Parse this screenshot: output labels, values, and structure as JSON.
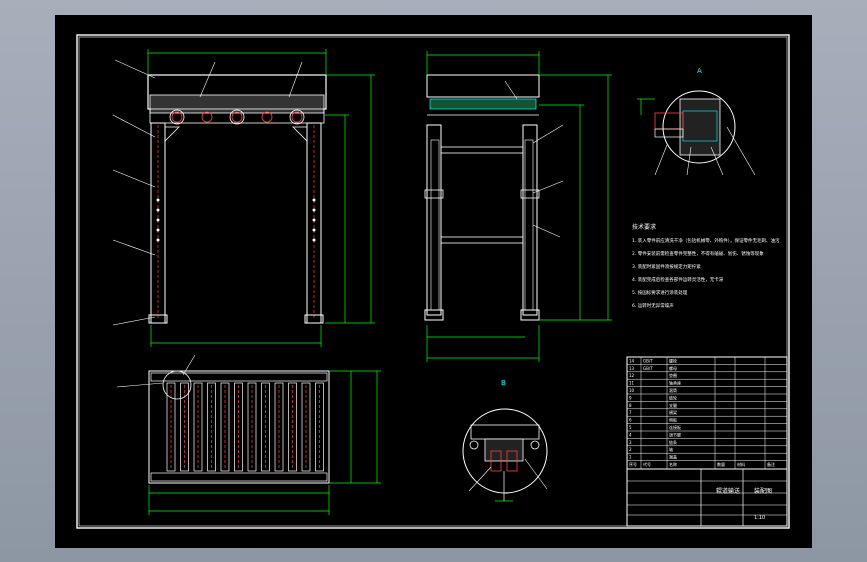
{
  "drawing": {
    "title": "Roller conveyor assembly drawing",
    "tech_requirements_title": "技术要求",
    "tech_requirements": [
      "1. 装入零件前应清洗干净（包括机械零、外购件），保证零件无毛刺、油污",
      "2. 零件安装前需检查零件完整性，不得有磕碰、划伤、锈蚀等现象",
      "3. 装配时紧固件须按规定力矩拧紧",
      "4. 装配完成后检查各部件运转灵活性，无卡滞",
      "5. 按国标要求进行涂装处理",
      "6. 运转时无异常噪声"
    ],
    "detail_labels": {
      "view_a": "A",
      "view_b": "B"
    }
  },
  "title_block": {
    "main_name": "辊道输送",
    "drawing_name": "装配图",
    "scale_hint": "1:10"
  },
  "bom": {
    "header": [
      "序号",
      "代号",
      "名称",
      "数量",
      "材料",
      "备注"
    ],
    "rows": [
      [
        "14",
        "GB/T",
        "螺栓",
        "",
        "",
        ""
      ],
      [
        "13",
        "GB/T",
        "螺母",
        "",
        "",
        ""
      ],
      [
        "12",
        "",
        "垫圈",
        "",
        "",
        ""
      ],
      [
        "11",
        "",
        "轴承座",
        "",
        "",
        ""
      ],
      [
        "10",
        "",
        "滚筒",
        "",
        "",
        ""
      ],
      [
        "9",
        "",
        "链轮",
        "",
        "",
        ""
      ],
      [
        "8",
        "",
        "支腿",
        "",
        "",
        ""
      ],
      [
        "7",
        "",
        "横梁",
        "",
        "",
        ""
      ],
      [
        "6",
        "",
        "侧板",
        "",
        "",
        ""
      ],
      [
        "5",
        "",
        "连接板",
        "",
        "",
        ""
      ],
      [
        "4",
        "",
        "调节脚",
        "",
        "",
        ""
      ],
      [
        "3",
        "",
        "链条",
        "",
        "",
        ""
      ],
      [
        "2",
        "",
        "轴",
        "",
        "",
        ""
      ],
      [
        "1",
        "",
        "端盖",
        "",
        "",
        ""
      ]
    ]
  },
  "colors": {
    "sheet": "#000000",
    "frame": "#ffffff",
    "dimension": "#00ff00",
    "part": "#ffffff",
    "hidden": "#ff3030",
    "accent": "#00ffff",
    "text": "#ffffff"
  }
}
